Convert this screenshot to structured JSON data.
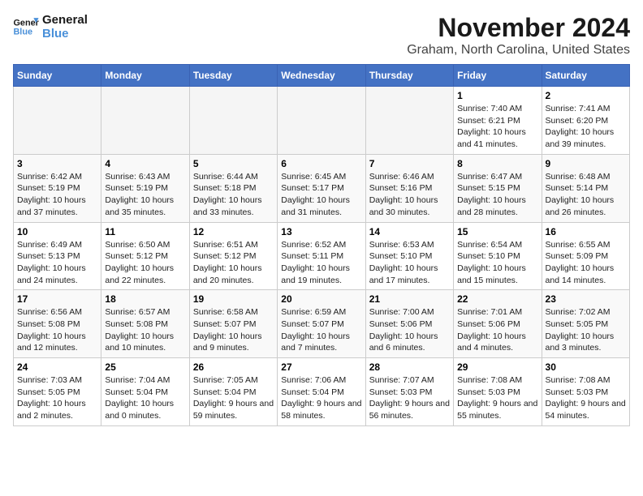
{
  "logo": {
    "line1": "General",
    "line2": "Blue"
  },
  "title": "November 2024",
  "location": "Graham, North Carolina, United States",
  "days_header": [
    "Sunday",
    "Monday",
    "Tuesday",
    "Wednesday",
    "Thursday",
    "Friday",
    "Saturday"
  ],
  "weeks": [
    [
      {
        "day": "",
        "empty": true
      },
      {
        "day": "",
        "empty": true
      },
      {
        "day": "",
        "empty": true
      },
      {
        "day": "",
        "empty": true
      },
      {
        "day": "",
        "empty": true
      },
      {
        "day": "1",
        "sunrise": "7:40 AM",
        "sunset": "6:21 PM",
        "daylight": "10 hours and 41 minutes."
      },
      {
        "day": "2",
        "sunrise": "7:41 AM",
        "sunset": "6:20 PM",
        "daylight": "10 hours and 39 minutes."
      }
    ],
    [
      {
        "day": "3",
        "sunrise": "6:42 AM",
        "sunset": "5:19 PM",
        "daylight": "10 hours and 37 minutes."
      },
      {
        "day": "4",
        "sunrise": "6:43 AM",
        "sunset": "5:19 PM",
        "daylight": "10 hours and 35 minutes."
      },
      {
        "day": "5",
        "sunrise": "6:44 AM",
        "sunset": "5:18 PM",
        "daylight": "10 hours and 33 minutes."
      },
      {
        "day": "6",
        "sunrise": "6:45 AM",
        "sunset": "5:17 PM",
        "daylight": "10 hours and 31 minutes."
      },
      {
        "day": "7",
        "sunrise": "6:46 AM",
        "sunset": "5:16 PM",
        "daylight": "10 hours and 30 minutes."
      },
      {
        "day": "8",
        "sunrise": "6:47 AM",
        "sunset": "5:15 PM",
        "daylight": "10 hours and 28 minutes."
      },
      {
        "day": "9",
        "sunrise": "6:48 AM",
        "sunset": "5:14 PM",
        "daylight": "10 hours and 26 minutes."
      }
    ],
    [
      {
        "day": "10",
        "sunrise": "6:49 AM",
        "sunset": "5:13 PM",
        "daylight": "10 hours and 24 minutes."
      },
      {
        "day": "11",
        "sunrise": "6:50 AM",
        "sunset": "5:12 PM",
        "daylight": "10 hours and 22 minutes."
      },
      {
        "day": "12",
        "sunrise": "6:51 AM",
        "sunset": "5:12 PM",
        "daylight": "10 hours and 20 minutes."
      },
      {
        "day": "13",
        "sunrise": "6:52 AM",
        "sunset": "5:11 PM",
        "daylight": "10 hours and 19 minutes."
      },
      {
        "day": "14",
        "sunrise": "6:53 AM",
        "sunset": "5:10 PM",
        "daylight": "10 hours and 17 minutes."
      },
      {
        "day": "15",
        "sunrise": "6:54 AM",
        "sunset": "5:10 PM",
        "daylight": "10 hours and 15 minutes."
      },
      {
        "day": "16",
        "sunrise": "6:55 AM",
        "sunset": "5:09 PM",
        "daylight": "10 hours and 14 minutes."
      }
    ],
    [
      {
        "day": "17",
        "sunrise": "6:56 AM",
        "sunset": "5:08 PM",
        "daylight": "10 hours and 12 minutes."
      },
      {
        "day": "18",
        "sunrise": "6:57 AM",
        "sunset": "5:08 PM",
        "daylight": "10 hours and 10 minutes."
      },
      {
        "day": "19",
        "sunrise": "6:58 AM",
        "sunset": "5:07 PM",
        "daylight": "10 hours and 9 minutes."
      },
      {
        "day": "20",
        "sunrise": "6:59 AM",
        "sunset": "5:07 PM",
        "daylight": "10 hours and 7 minutes."
      },
      {
        "day": "21",
        "sunrise": "7:00 AM",
        "sunset": "5:06 PM",
        "daylight": "10 hours and 6 minutes."
      },
      {
        "day": "22",
        "sunrise": "7:01 AM",
        "sunset": "5:06 PM",
        "daylight": "10 hours and 4 minutes."
      },
      {
        "day": "23",
        "sunrise": "7:02 AM",
        "sunset": "5:05 PM",
        "daylight": "10 hours and 3 minutes."
      }
    ],
    [
      {
        "day": "24",
        "sunrise": "7:03 AM",
        "sunset": "5:05 PM",
        "daylight": "10 hours and 2 minutes."
      },
      {
        "day": "25",
        "sunrise": "7:04 AM",
        "sunset": "5:04 PM",
        "daylight": "10 hours and 0 minutes."
      },
      {
        "day": "26",
        "sunrise": "7:05 AM",
        "sunset": "5:04 PM",
        "daylight": "9 hours and 59 minutes."
      },
      {
        "day": "27",
        "sunrise": "7:06 AM",
        "sunset": "5:04 PM",
        "daylight": "9 hours and 58 minutes."
      },
      {
        "day": "28",
        "sunrise": "7:07 AM",
        "sunset": "5:03 PM",
        "daylight": "9 hours and 56 minutes."
      },
      {
        "day": "29",
        "sunrise": "7:08 AM",
        "sunset": "5:03 PM",
        "daylight": "9 hours and 55 minutes."
      },
      {
        "day": "30",
        "sunrise": "7:08 AM",
        "sunset": "5:03 PM",
        "daylight": "9 hours and 54 minutes."
      }
    ]
  ]
}
